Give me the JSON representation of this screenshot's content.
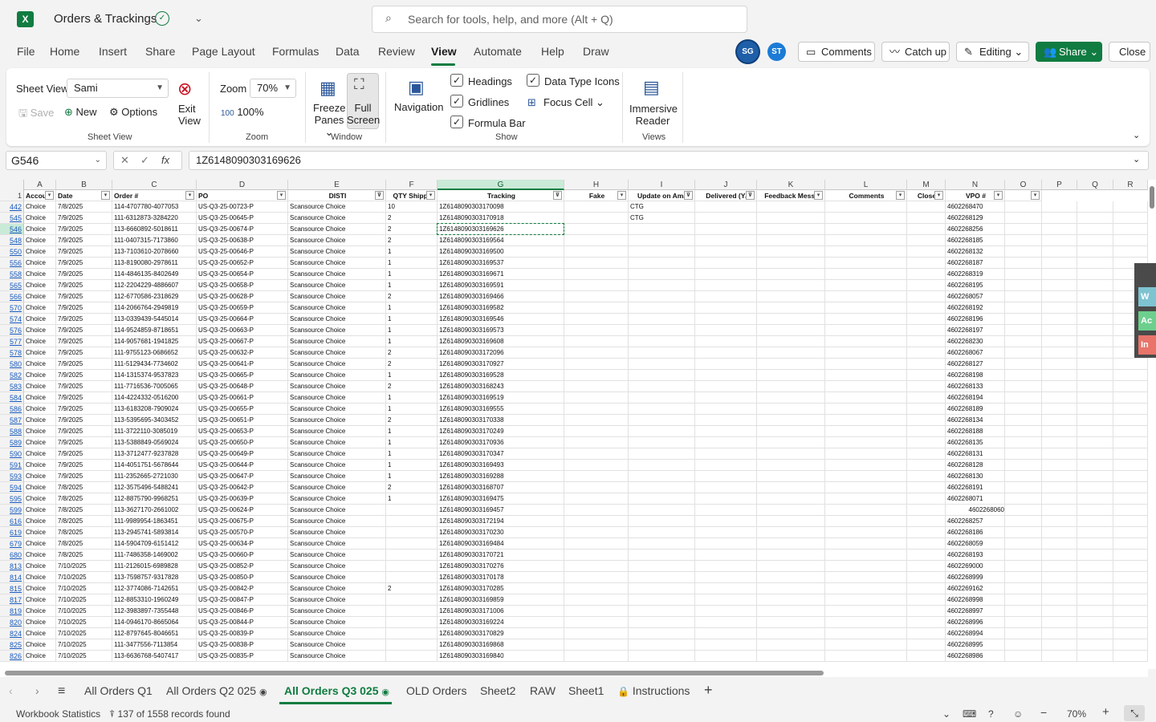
{
  "title_bar": {
    "app_logo": "X",
    "doc_title": "Orders & Trackings",
    "search_placeholder": "Search for tools, help, and more (Alt + Q)"
  },
  "menu": [
    "File",
    "Home",
    "Insert",
    "Share",
    "Page Layout",
    "Formulas",
    "Data",
    "Review",
    "View",
    "Automate",
    "Help",
    "Draw"
  ],
  "active_menu": "View",
  "users": [
    "SG",
    "ST"
  ],
  "top_buttons": {
    "comments": "Comments",
    "catch_up": "Catch up",
    "editing": "Editing",
    "share": "Share",
    "close": "Close"
  },
  "ribbon": {
    "sheet_view": {
      "label": "Sheet View",
      "value": "Sami",
      "save": "Save",
      "new": "New",
      "options": "Options",
      "exit": "Exit",
      "view": "View",
      "group": "Sheet View"
    },
    "zoom": {
      "label": "Zoom",
      "value": "70%",
      "hundred": "100%",
      "group": "Zoom"
    },
    "window": {
      "freeze": "Freeze",
      "panes": "Panes",
      "full": "Full",
      "screen": "Screen",
      "group": "Window"
    },
    "navigation": "Navigation",
    "show": {
      "headings": "Headings",
      "gridlines": "Gridlines",
      "formula_bar": "Formula Bar",
      "data_type_icons": "Data Type Icons",
      "focus_cell": "Focus Cell",
      "group": "Show"
    },
    "views": {
      "immersive": "Immersive",
      "reader": "Reader",
      "group": "Views"
    }
  },
  "formula_bar": {
    "name_box": "G546",
    "formula": "1Z6148090303169626",
    "fx": "fx"
  },
  "columns": [
    "A",
    "B",
    "C",
    "D",
    "E",
    "F",
    "G",
    "H",
    "I",
    "J",
    "K",
    "L",
    "M",
    "N",
    "O",
    "P",
    "Q",
    "R"
  ],
  "header_row": {
    "num": "1",
    "cells": [
      "Accou",
      "Date",
      "Order #",
      "PO",
      "DISTI",
      "QTY Shippe",
      "Tracking",
      "Fake",
      "Update on Ama",
      "Delivered (Y/",
      "Feedback Messa",
      "Comments",
      "Close",
      "VPO #"
    ]
  },
  "rows": [
    {
      "n": "442",
      "b": "7/8/2025",
      "c": "114-4707780-4077053",
      "d": "US-Q3-25-00723-P",
      "f": "10",
      "g": "1Z6148090303170098",
      "i": "CTG",
      "v": "4602268470"
    },
    {
      "n": "545",
      "b": "7/9/2025",
      "c": "111-6312873-3284220",
      "d": "US-Q3-25-00645-P",
      "f": "2",
      "g": "1Z6148090303170918",
      "i": "CTG",
      "v": "4602268129"
    },
    {
      "n": "546",
      "b": "7/9/2025",
      "c": "113-6660892-5018611",
      "d": "US-Q3-25-00674-P",
      "f": "2",
      "g": "1Z6148090303169626",
      "i": "",
      "v": "4602268256"
    },
    {
      "n": "548",
      "b": "7/9/2025",
      "c": "111-0407315-7173860",
      "d": "US-Q3-25-00638-P",
      "f": "2",
      "g": "1Z6148090303169564",
      "i": "",
      "v": "4602268185"
    },
    {
      "n": "550",
      "b": "7/9/2025",
      "c": "113-7103610-2078660",
      "d": "US-Q3-25-00646-P",
      "f": "1",
      "g": "1Z6148090303169500",
      "i": "",
      "v": "4602268132"
    },
    {
      "n": "556",
      "b": "7/9/2025",
      "c": "113-8190080-2978611",
      "d": "US-Q3-25-00652-P",
      "f": "1",
      "g": "1Z6148090303169537",
      "i": "",
      "v": "4602268187"
    },
    {
      "n": "558",
      "b": "7/9/2025",
      "c": "114-4846135-8402649",
      "d": "US-Q3-25-00654-P",
      "f": "1",
      "g": "1Z6148090303169671",
      "i": "",
      "v": "4602268319"
    },
    {
      "n": "565",
      "b": "7/9/2025",
      "c": "112-2204229-4886607",
      "d": "US-Q3-25-00658-P",
      "f": "1",
      "g": "1Z6148090303169591",
      "i": "",
      "v": "4602268195"
    },
    {
      "n": "566",
      "b": "7/9/2025",
      "c": "112-6770586-2318629",
      "d": "US-Q3-25-00628-P",
      "f": "2",
      "g": "1Z6148090303169466",
      "i": "",
      "v": "4602268057"
    },
    {
      "n": "570",
      "b": "7/9/2025",
      "c": "114-2066764-2949819",
      "d": "US-Q3-25-00659-P",
      "f": "1",
      "g": "1Z6148090303169582",
      "i": "",
      "v": "4602268192"
    },
    {
      "n": "574",
      "b": "7/9/2025",
      "c": "113-0339439-5445014",
      "d": "US-Q3-25-00664-P",
      "f": "1",
      "g": "1Z6148090303169546",
      "i": "",
      "v": "4602268196"
    },
    {
      "n": "576",
      "b": "7/9/2025",
      "c": "114-9524859-8718651",
      "d": "US-Q3-25-00663-P",
      "f": "1",
      "g": "1Z6148090303169573",
      "i": "",
      "v": "4602268197"
    },
    {
      "n": "577",
      "b": "7/9/2025",
      "c": "114-9057681-1941825",
      "d": "US-Q3-25-00667-P",
      "f": "1",
      "g": "1Z6148090303169608",
      "i": "",
      "v": "4602268230"
    },
    {
      "n": "578",
      "b": "7/9/2025",
      "c": "111-9755123-0686652",
      "d": "US-Q3-25-00632-P",
      "f": "2",
      "g": "1Z6148090303172096",
      "i": "",
      "v": "4602268067"
    },
    {
      "n": "580",
      "b": "7/9/2025",
      "c": "111-5129434-7734602",
      "d": "US-Q3-25-00641-P",
      "f": "2",
      "g": "1Z6148090303170927",
      "i": "",
      "v": "4602268127"
    },
    {
      "n": "582",
      "b": "7/9/2025",
      "c": "114-1315374-9537823",
      "d": "US-Q3-25-00665-P",
      "f": "1",
      "g": "1Z6148090303169528",
      "i": "",
      "v": "4602268198"
    },
    {
      "n": "583",
      "b": "7/9/2025",
      "c": "111-7716536-7005065",
      "d": "US-Q3-25-00648-P",
      "f": "2",
      "g": "1Z6148090303168243",
      "i": "",
      "v": "4602268133"
    },
    {
      "n": "584",
      "b": "7/9/2025",
      "c": "114-4224332-0516200",
      "d": "US-Q3-25-00661-P",
      "f": "1",
      "g": "1Z6148090303169519",
      "i": "",
      "v": "4602268194"
    },
    {
      "n": "586",
      "b": "7/9/2025",
      "c": "113-6183208-7909024",
      "d": "US-Q3-25-00655-P",
      "f": "1",
      "g": "1Z6148090303169555",
      "i": "",
      "v": "4602268189"
    },
    {
      "n": "587",
      "b": "7/9/2025",
      "c": "113-5395695-3403452",
      "d": "US-Q3-25-00651-P",
      "f": "2",
      "g": "1Z6148090303170338",
      "i": "",
      "v": "4602268134"
    },
    {
      "n": "588",
      "b": "7/9/2025",
      "c": "111-3722110-3085019",
      "d": "US-Q3-25-00653-P",
      "f": "1",
      "g": "1Z6148090303170249",
      "i": "",
      "v": "4602268188"
    },
    {
      "n": "589",
      "b": "7/9/2025",
      "c": "113-5388849-0569024",
      "d": "US-Q3-25-00650-P",
      "f": "1",
      "g": "1Z6148090303170936",
      "i": "",
      "v": "4602268135"
    },
    {
      "n": "590",
      "b": "7/9/2025",
      "c": "113-3712477-9237828",
      "d": "US-Q3-25-00649-P",
      "f": "1",
      "g": "1Z6148090303170347",
      "i": "",
      "v": "4602268131"
    },
    {
      "n": "591",
      "b": "7/9/2025",
      "c": "114-4051751-5678644",
      "d": "US-Q3-25-00644-P",
      "f": "1",
      "g": "1Z6148090303169493",
      "i": "",
      "v": "4602268128"
    },
    {
      "n": "593",
      "b": "7/9/2025",
      "c": "111-2352665-2721030",
      "d": "US-Q3-25-00647-P",
      "f": "1",
      "g": "1Z6148090303169288",
      "i": "",
      "v": "4602268130"
    },
    {
      "n": "594",
      "b": "7/8/2025",
      "c": "112-3575496-5488241",
      "d": "US-Q3-25-00642-P",
      "f": "2",
      "g": "1Z6148090303168707",
      "i": "",
      "v": "4602268191"
    },
    {
      "n": "595",
      "b": "7/8/2025",
      "c": "112-8875790-9968251",
      "d": "US-Q3-25-00639-P",
      "f": "1",
      "g": "1Z6148090303169475",
      "i": "",
      "v": "4602268071"
    },
    {
      "n": "599",
      "b": "7/8/2025",
      "c": "113-3627170-2661002",
      "d": "US-Q3-25-00624-P",
      "f": "",
      "g": "1Z6148090303169457",
      "i": "",
      "v": "4602268060"
    },
    {
      "n": "616",
      "b": "7/8/2025",
      "c": "111-9989954-1863451",
      "d": "US-Q3-25-00675-P",
      "f": "",
      "g": "1Z6148090303172194",
      "i": "",
      "v": "4602268257"
    },
    {
      "n": "619",
      "b": "7/8/2025",
      "c": "113-2945741-5893814",
      "d": "US-Q3-25-00570-P",
      "f": "",
      "g": "1Z6148090303170230",
      "i": "",
      "v": "4602268186"
    },
    {
      "n": "679",
      "b": "7/8/2025",
      "c": "114-5904709-6151412",
      "d": "US-Q3-25-00634-P",
      "f": "",
      "g": "1Z6148090303169484",
      "i": "",
      "v": "4602268059"
    },
    {
      "n": "680",
      "b": "7/8/2025",
      "c": "111-7486358-1469002",
      "d": "US-Q3-25-00660-P",
      "f": "",
      "g": "1Z6148090303170721",
      "i": "",
      "v": "4602268193"
    },
    {
      "n": "813",
      "b": "7/10/2025",
      "c": "111-2126015-6989828",
      "d": "US-Q3-25-00852-P",
      "f": "",
      "g": "1Z6148090303170276",
      "i": "",
      "v": "4602269000"
    },
    {
      "n": "814",
      "b": "7/10/2025",
      "c": "113-7598757-9317828",
      "d": "US-Q3-25-00850-P",
      "f": "",
      "g": "1Z6148090303170178",
      "i": "",
      "v": "4602268999"
    },
    {
      "n": "815",
      "b": "7/10/2025",
      "c": "112-3774086-7142651",
      "d": "US-Q3-25-00842-P",
      "f": "2",
      "g": "1Z6148090303170285",
      "i": "",
      "v": "4602269162"
    },
    {
      "n": "817",
      "b": "7/10/2025",
      "c": "112-8853310-1960249",
      "d": "US-Q3-25-00847-P",
      "f": "",
      "g": "1Z6148090303169859",
      "i": "",
      "v": "4602268998"
    },
    {
      "n": "819",
      "b": "7/10/2025",
      "c": "112-3983897-7355448",
      "d": "US-Q3-25-00846-P",
      "f": "",
      "g": "1Z6148090303171006",
      "i": "",
      "v": "4602268997"
    },
    {
      "n": "820",
      "b": "7/10/2025",
      "c": "114-0946170-8665064",
      "d": "US-Q3-25-00844-P",
      "f": "",
      "g": "1Z6148090303169224",
      "i": "",
      "v": "4602268996"
    },
    {
      "n": "824",
      "b": "7/10/2025",
      "c": "112-8797645-8046651",
      "d": "US-Q3-25-00839-P",
      "f": "",
      "g": "1Z6148090303170829",
      "i": "",
      "v": "4602268994"
    },
    {
      "n": "825",
      "b": "7/10/2025",
      "c": "111-3477556-7113854",
      "d": "US-Q3-25-00838-P",
      "f": "",
      "g": "1Z6148090303169868",
      "i": "",
      "v": "4602268995"
    },
    {
      "n": "826",
      "b": "7/10/2025",
      "c": "113-6636768-5407417",
      "d": "US-Q3-25-00835-P",
      "f": "",
      "g": "1Z6148090303169840",
      "i": "",
      "v": "4602268986"
    }
  ],
  "row_account": "Choice",
  "row_disti": "Scansource Choice",
  "side_widget": [
    "W",
    "Ac",
    "In"
  ],
  "sheet_tabs": [
    "All Orders Q1",
    "All Orders Q2 025",
    "All Orders Q3 025",
    "OLD Orders",
    "Sheet2",
    "RAW",
    "Sheet1",
    "Instructions"
  ],
  "active_tab": "All Orders Q3 025",
  "status": {
    "workbook_stats": "Workbook Statistics",
    "records": "137 of 1558 records found",
    "zoom": "70%"
  },
  "colors": {
    "accent": "#107c41",
    "link": "#185abd"
  }
}
